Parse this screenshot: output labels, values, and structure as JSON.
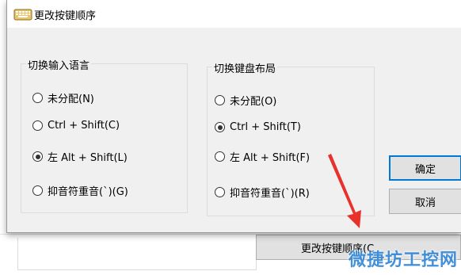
{
  "dialog": {
    "title": "更改按键顺序",
    "input_language_group": {
      "legend": "切换输入语言",
      "options": [
        {
          "label": "未分配(N)",
          "checked": false
        },
        {
          "label": "Ctrl + Shift(C)",
          "checked": false
        },
        {
          "label": "左 Alt + Shift(L)",
          "checked": true
        },
        {
          "label": "抑音符重音(`)(G)",
          "checked": false
        }
      ]
    },
    "keyboard_layout_group": {
      "legend": "切换键盘布局",
      "options": [
        {
          "label": "未分配(O)",
          "checked": false
        },
        {
          "label": "Ctrl + Shift(T)",
          "checked": true
        },
        {
          "label": "左 Alt + Shift(F)",
          "checked": false
        },
        {
          "label": "抑音符重音(`)(R)",
          "checked": false
        }
      ]
    },
    "ok_label": "确定",
    "cancel_label": "取消"
  },
  "background": {
    "change_key_sequence_label": "更改按键顺序(C"
  },
  "watermark": {
    "text": "微捷坊工控网"
  },
  "colors": {
    "accent": "#0078d7",
    "arrow": "#e8312b",
    "watermark": "#2f86d6"
  }
}
